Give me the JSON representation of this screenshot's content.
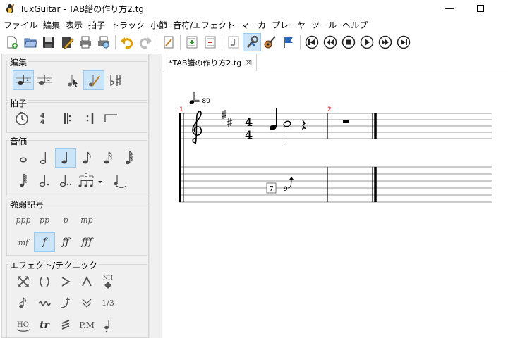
{
  "window": {
    "title": "TuxGuitar - TAB譜の作り方2.tg",
    "minimize": "—",
    "maximize": "☐"
  },
  "menu": [
    "ファイル",
    "編集",
    "表示",
    "拍子",
    "トラック",
    "小節",
    "音符/エフェクト",
    "マーカ",
    "プレーヤ",
    "ツール",
    "ヘルプ"
  ],
  "toolbar": {
    "icons": [
      "new-file",
      "open-file",
      "save",
      "edit-file",
      "print",
      "print-preview",
      "undo",
      "redo",
      "song-properties",
      "add-track",
      "remove-track",
      "note-mode",
      "edit-mode",
      "tuner",
      "marker",
      "first",
      "previous",
      "stop",
      "play",
      "next",
      "last"
    ]
  },
  "side_panel": {
    "groups": [
      {
        "title": "編集",
        "voice1": "1",
        "voice2": "2"
      },
      {
        "title": "拍子"
      },
      {
        "title": "音価"
      },
      {
        "title": "強弱記号",
        "dynamics": [
          "ppp",
          "pp",
          "p",
          "mp",
          "mf",
          "f",
          "ff",
          "fff"
        ],
        "active": "f"
      },
      {
        "title": "エフェクト/テクニック",
        "labels": [
          "NH",
          "1/3",
          "HO",
          "tr",
          "P.M"
        ]
      }
    ],
    "tuplet_label": "3"
  },
  "document_tab": {
    "label": "*TAB譜の作り方2.tg",
    "close": "☒"
  },
  "score": {
    "tempo": "= 80",
    "measure_numbers": [
      "1",
      "2"
    ],
    "time_signature": {
      "top": "4",
      "bottom": "4"
    },
    "tab_fret_boxed": "7",
    "tab_fret": "9"
  },
  "colors": {
    "active_bg": "#cce4f7",
    "measure_number": "#cc0000",
    "panel_bg": "#f0f0f0"
  }
}
